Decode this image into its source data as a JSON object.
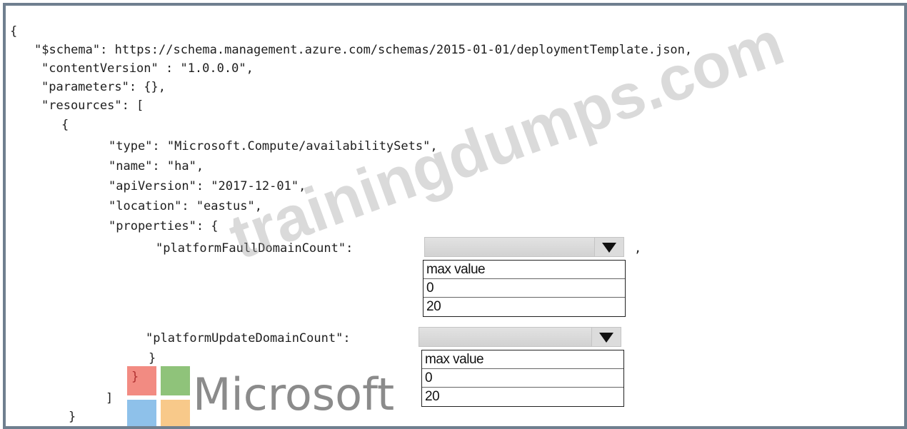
{
  "code": {
    "l1": "{",
    "l2": "\"$schema\": https://schema.management.azure.com/schemas/2015-01-01/deploymentTemplate.json,",
    "l3": "\"contentVersion\" : \"1.0.0.0\",",
    "l4": "\"parameters\": {},",
    "l5": "\"resources\": [",
    "l6": "{",
    "l7": "\"type\": \"Microsoft.Compute/availabilitySets\",",
    "l8": "\"name\": \"ha\",",
    "l9": "\"apiVersion\": \"2017-12-01\",",
    "l10": "\"location\": \"eastus\",",
    "l11": "\"properties\": {",
    "l12": "\"platformFaullDomainCount\":",
    "l12_suffix": ",",
    "l13": "\"platformUpdateDomainCount\":",
    "l14": "}",
    "l15": "}",
    "l16": "]",
    "l17": "}"
  },
  "fault_dropdown": {
    "selected": "",
    "options": [
      "max value",
      "0",
      "20"
    ]
  },
  "update_dropdown": {
    "selected": "",
    "options": [
      "max value",
      "0",
      "20"
    ]
  },
  "watermark": "trainingdumps.com",
  "logo": {
    "text": "Microsoft",
    "colors": [
      "#f28b82",
      "#8fc37a",
      "#8ec1ea",
      "#f8c98a"
    ]
  }
}
